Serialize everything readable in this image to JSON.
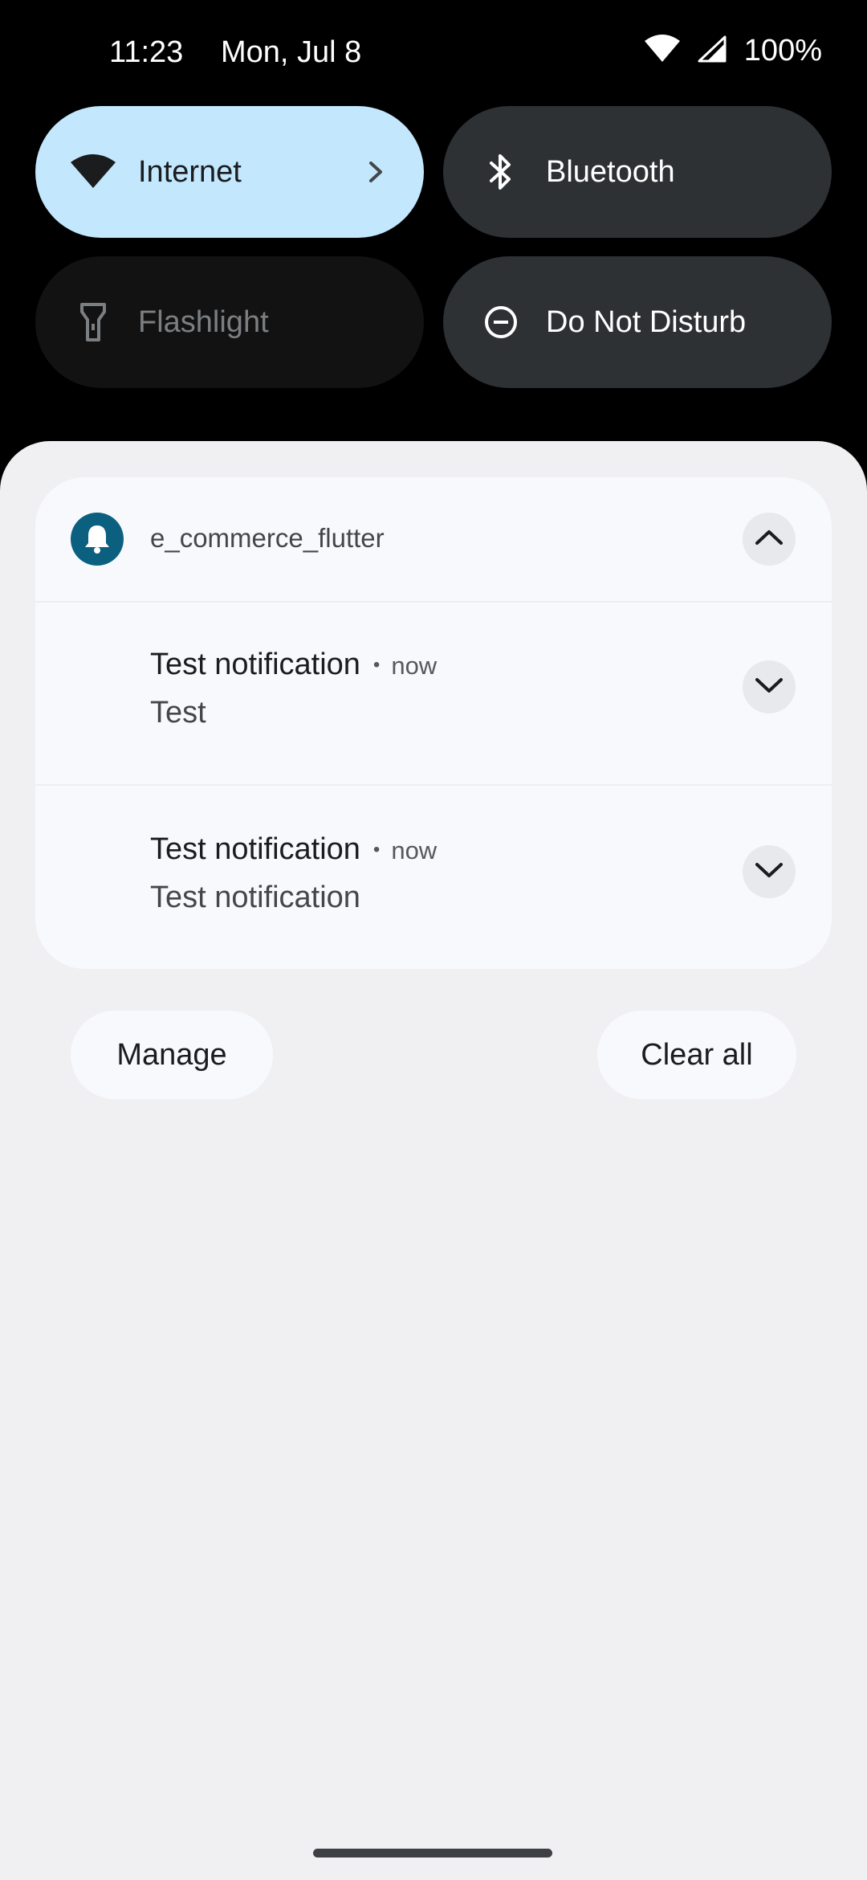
{
  "status_bar": {
    "time": "11:23",
    "date": "Mon, Jul 8",
    "battery": "100%",
    "icons": [
      "wifi-icon",
      "cell-signal-icon"
    ]
  },
  "quick_settings": {
    "internet": {
      "label": "Internet",
      "icon": "wifi-icon",
      "state": "on"
    },
    "bluetooth": {
      "label": "Bluetooth",
      "icon": "bluetooth-icon",
      "state": "off"
    },
    "flashlight": {
      "label": "Flashlight",
      "icon": "flashlight-icon",
      "state": "unavailable"
    },
    "dnd": {
      "label": "Do Not Disturb",
      "icon": "minus-circle-icon",
      "state": "off"
    }
  },
  "notification_group": {
    "app_name": "e_commerce_flutter",
    "app_icon": "bell-icon",
    "app_color": "#0c607f",
    "notifications": [
      {
        "title": "Test notification",
        "separator": "•",
        "time": "now",
        "body": "Test"
      },
      {
        "title": "Test notification",
        "separator": "•",
        "time": "now",
        "body": "Test notification"
      }
    ]
  },
  "actions": {
    "manage": "Manage",
    "clear_all": "Clear all"
  },
  "colors": {
    "internet_tile": "#c3e7fd",
    "dark_tile": "#2e3134",
    "shade_bg": "#f0f0f3",
    "card_bg": "#f8f9fd"
  }
}
